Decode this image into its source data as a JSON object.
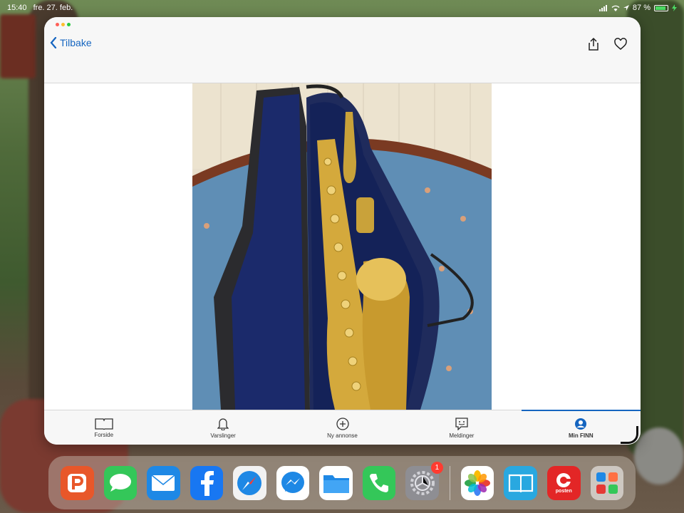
{
  "status_bar": {
    "time": "15:40",
    "date": "fre. 27. feb.",
    "battery": "87 %"
  },
  "nav": {
    "back_label": "Tilbake"
  },
  "tabs": [
    {
      "label": "Forside",
      "icon": "book-icon"
    },
    {
      "label": "Varslinger",
      "icon": "bell-icon"
    },
    {
      "label": "Ny annonse",
      "icon": "plus-circle-icon"
    },
    {
      "label": "Meldinger",
      "icon": "chat-icon"
    },
    {
      "label": "Min FINN",
      "icon": "profile-icon"
    }
  ],
  "active_tab": "Min FINN",
  "dock": {
    "apps": [
      "Parkering",
      "Messages",
      "Mail",
      "Facebook",
      "Safari",
      "Messenger",
      "Files",
      "Phone",
      "Settings",
      "Photos",
      "Books",
      "Posten",
      "Folder"
    ],
    "settings_badge": "1",
    "posten_label": "posten"
  },
  "colors": {
    "accent": "#1565c0",
    "badge": "#ff3b30"
  }
}
